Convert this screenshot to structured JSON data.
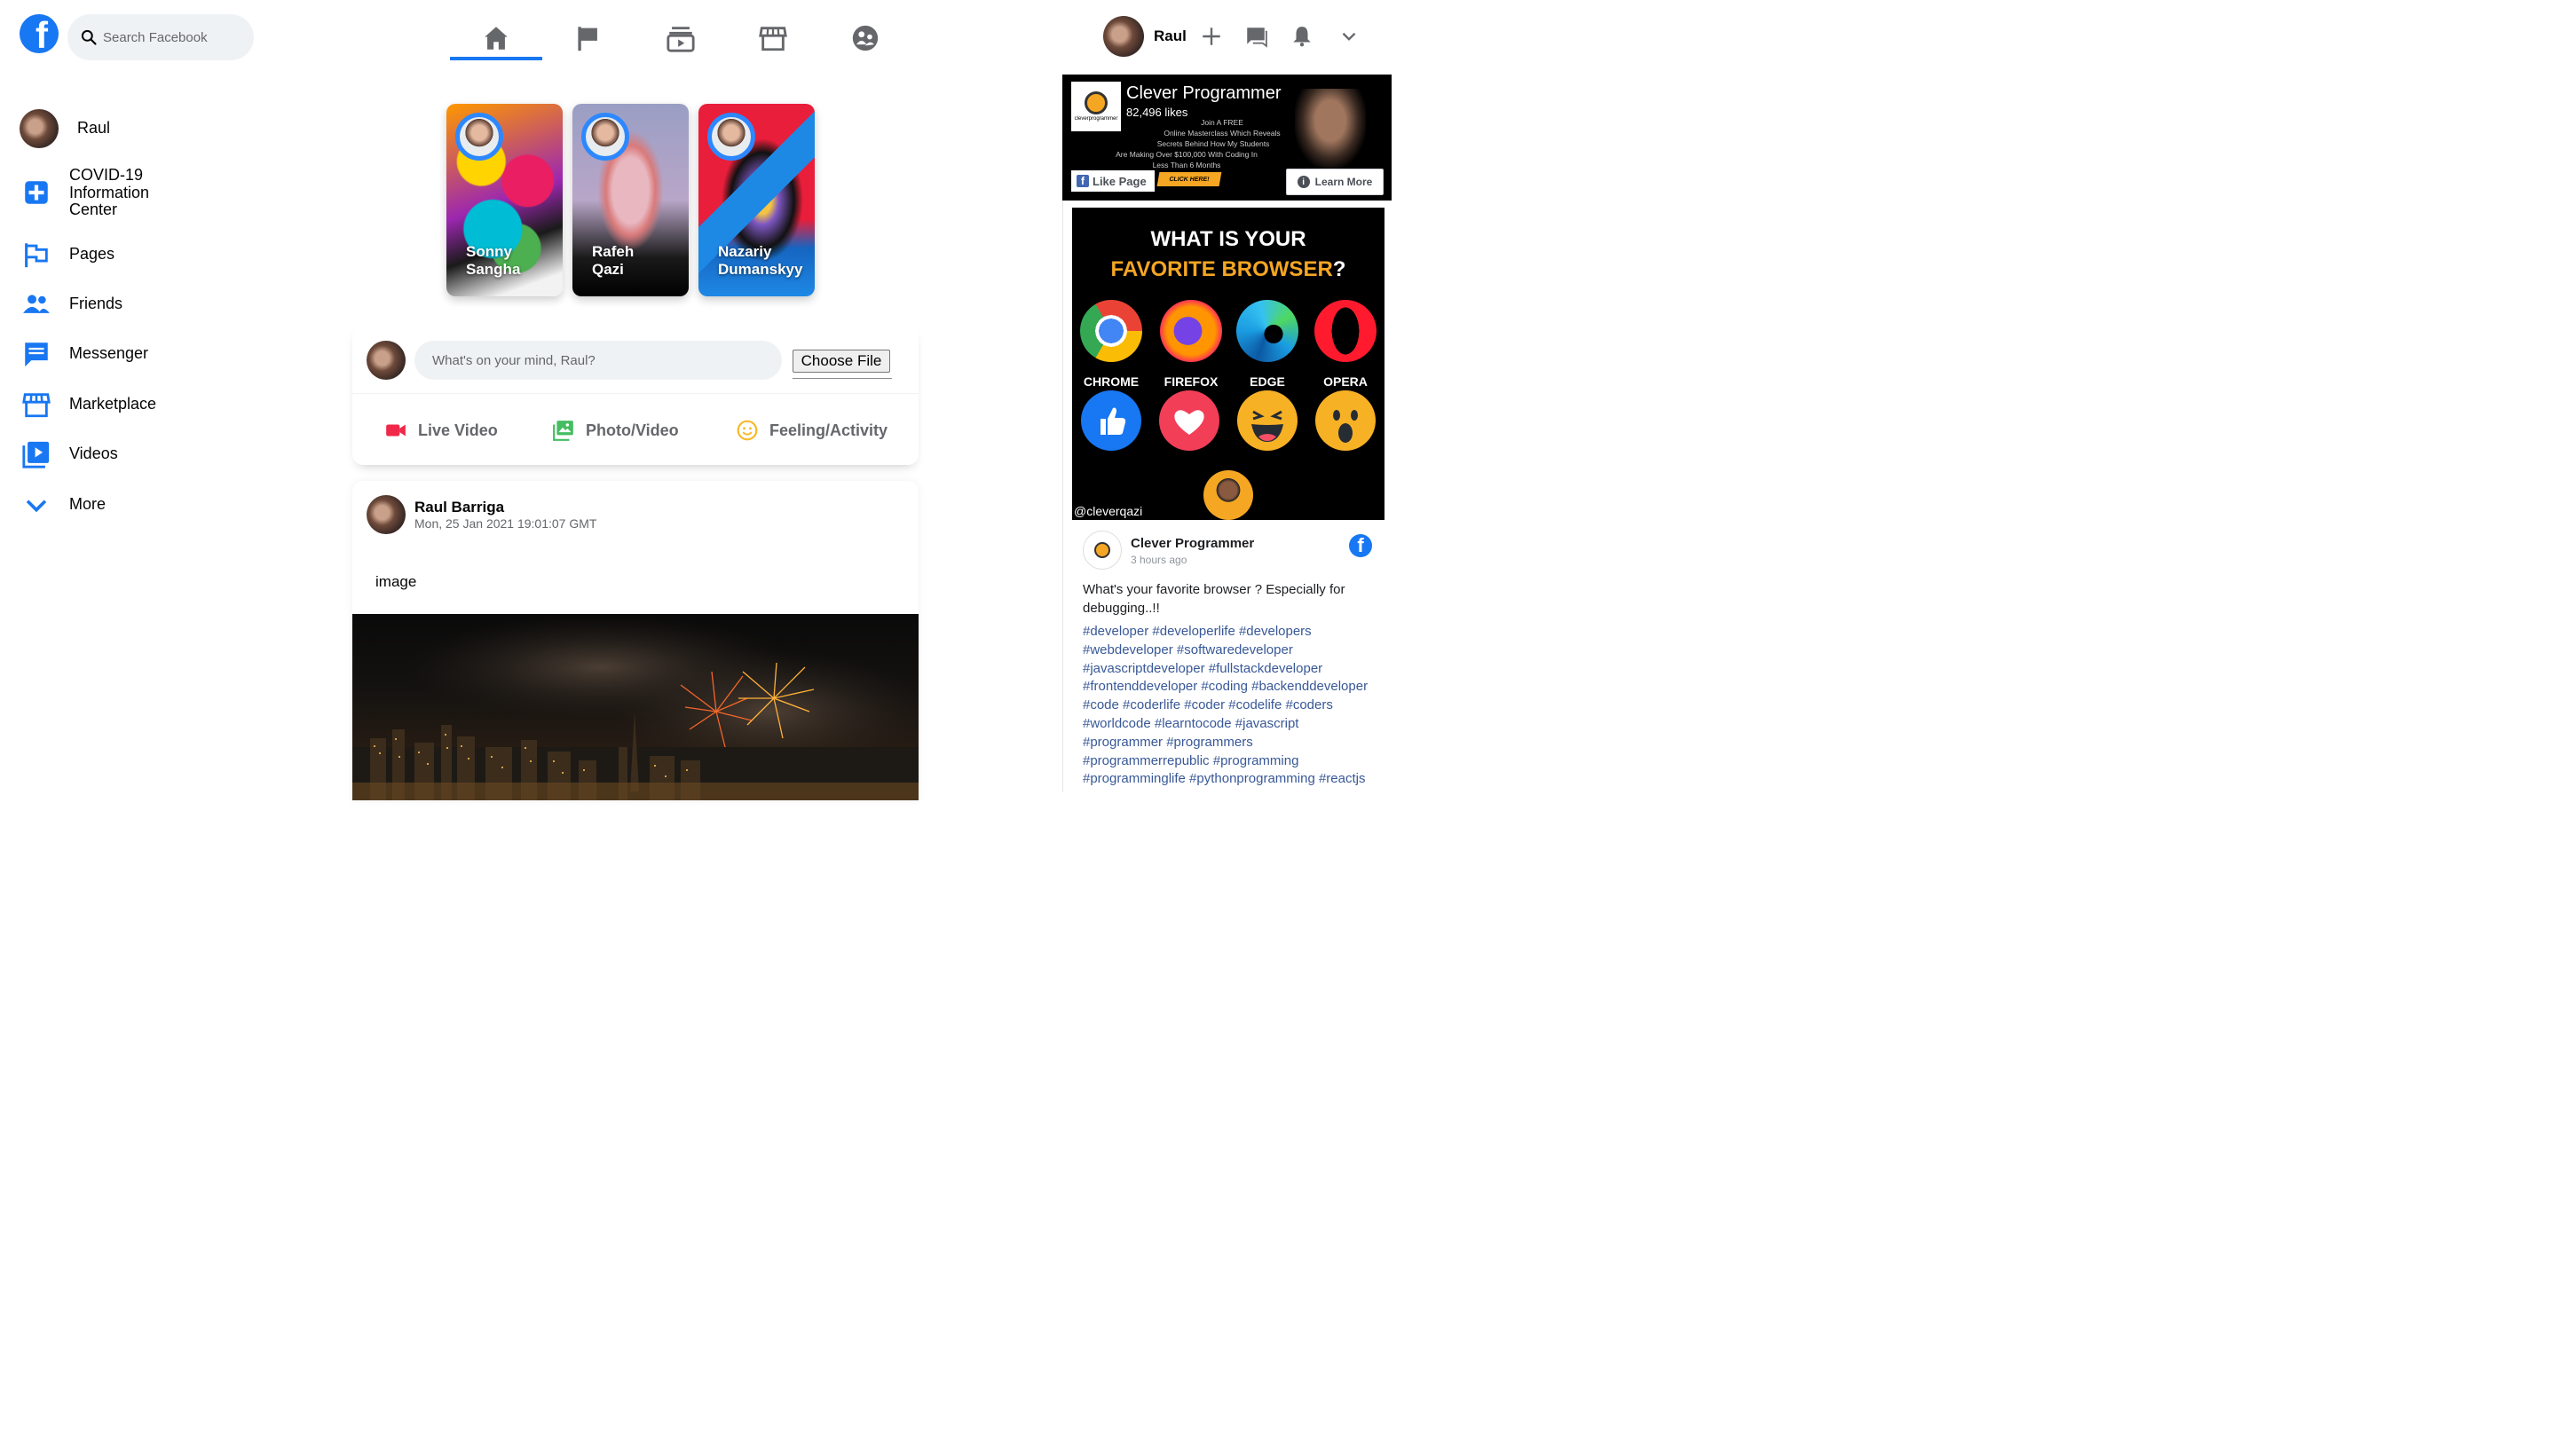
{
  "header": {
    "search_placeholder": "Search Facebook",
    "nav": [
      "home",
      "pages",
      "watch",
      "marketplace",
      "groups"
    ],
    "active_nav": "home",
    "user_name": "Raul"
  },
  "sidebar": {
    "user_name": "Raul",
    "items": [
      {
        "label": "COVID-19 Information Center",
        "icon": "plus-box-icon"
      },
      {
        "label": "Pages",
        "icon": "flag-icon"
      },
      {
        "label": "Friends",
        "icon": "people-icon"
      },
      {
        "label": "Messenger",
        "icon": "chat-icon"
      },
      {
        "label": "Marketplace",
        "icon": "store-icon"
      },
      {
        "label": "Videos",
        "icon": "video-icon"
      },
      {
        "label": "More",
        "icon": "chevron-down-icon"
      }
    ]
  },
  "stories": [
    {
      "name": "Sonny Sangha"
    },
    {
      "name": "Rafeh Qazi"
    },
    {
      "name": "Nazariy Dumanskyy"
    }
  ],
  "composer": {
    "placeholder": "What's on your mind, Raul?",
    "file_button": "Choose File",
    "actions": [
      "Live Video",
      "Photo/Video",
      "Feeling/Activity"
    ]
  },
  "post": {
    "author": "Raul Barriga",
    "timestamp": "Mon, 25 Jan 2021 19:01:07 GMT",
    "text": "image"
  },
  "ad": {
    "page_name": "Clever Programmer",
    "likes": "82,496 likes",
    "like_button": "Like Page",
    "click_here": "CLICK HERE!",
    "learn_more": "Learn More",
    "blurb_line1": "Join A FREE",
    "blurb_line2": "Online Masterclass Which Reveals",
    "blurb_line3": "Secrets Behind How My Students",
    "blurb_line4": "Are Making Over $100,000 With Coding In",
    "blurb_line5": "Less Than 6 Months"
  },
  "browser_post": {
    "question_line1": "WHAT IS YOUR",
    "question_line2a": "FAVORITE BROWSER",
    "question_line2b": "?",
    "browsers": [
      "CHROME",
      "FIREFOX",
      "EDGE",
      "OPERA"
    ],
    "handle": "@cleverqazi",
    "author": "Clever Programmer",
    "time": "3 hours ago",
    "text": "What's your favorite browser ? Especially for debugging..!!",
    "hashtags": "#developer #developerlife #developers #webdeveloper #softwaredeveloper #javascriptdeveloper #fullstackdeveloper #frontenddeveloper #coding #backenddeveloper #code #coderlife #coder #codelife #coders #worldcode #learntocode #javascript #programmer #programmers #programmerrepublic #programming #programminglife #pythonprogramming #reactjs"
  },
  "colors": {
    "brand": "#1877f2",
    "live_video": "#f02849",
    "photo_video": "#45bd62",
    "feeling": "#f7b928",
    "text_secondary": "#65676b"
  }
}
